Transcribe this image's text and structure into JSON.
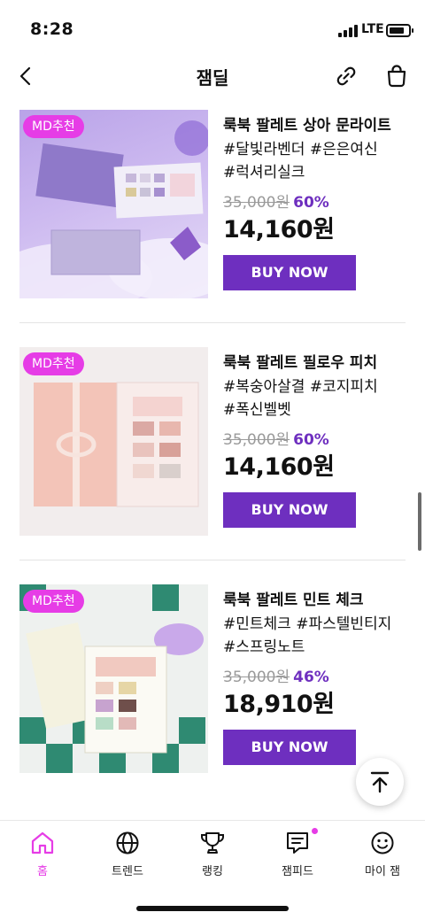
{
  "status_bar": {
    "time": "8:28",
    "network": "LTE"
  },
  "header": {
    "title": "잼딜"
  },
  "badge_label": "MD추천",
  "products": [
    {
      "name": "룩북 팔레트 상아 문라이트",
      "tags": [
        "#달빛라벤더 #은은여신",
        "#럭셔리실크"
      ],
      "original_price": "35,000원",
      "discount": "60%",
      "price": "14,160원",
      "button": "BUY NOW"
    },
    {
      "name": "룩북 팔레트 필로우 피치",
      "tags": [
        "#복숭아살결 #코지피치",
        "#폭신벨벳"
      ],
      "original_price": "35,000원",
      "discount": "60%",
      "price": "14,160원",
      "button": "BUY NOW"
    },
    {
      "name": "룩북 팔레트 민트 체크",
      "tags": [
        "#민트체크 #파스텔빈티지",
        "#스프링노트"
      ],
      "original_price": "35,000원",
      "discount": "46%",
      "price": "18,910원",
      "button": "BUY NOW"
    }
  ],
  "bottom_nav": [
    {
      "label": "홈",
      "icon": "home-icon",
      "active": true
    },
    {
      "label": "트렌드",
      "icon": "globe-icon",
      "active": false
    },
    {
      "label": "랭킹",
      "icon": "trophy-icon",
      "active": false
    },
    {
      "label": "잼피드",
      "icon": "chat-icon",
      "active": false
    },
    {
      "label": "마이 잼",
      "icon": "smile-icon",
      "active": false
    }
  ],
  "colors": {
    "accent": "#6e2fbf",
    "badge": "#e63ce6"
  }
}
